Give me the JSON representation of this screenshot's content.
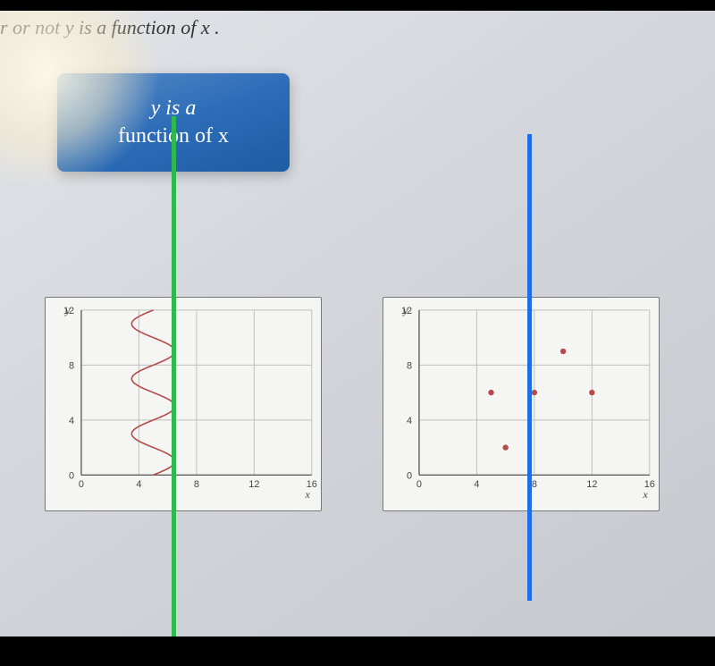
{
  "question": {
    "fragment": "r or not y is a function of x ."
  },
  "label_card": {
    "line1": "y is a",
    "line2": "function of x"
  },
  "axes": {
    "y_label": "y",
    "x_label": "x",
    "y_ticks": [
      0,
      4,
      8,
      12
    ],
    "x_ticks": [
      0,
      4,
      8,
      12,
      16
    ]
  },
  "chart_data": [
    {
      "type": "line",
      "title": "",
      "xlabel": "x",
      "ylabel": "y",
      "xlim": [
        0,
        16
      ],
      "ylim": [
        0,
        12
      ],
      "description": "Vertical sinusoidal curve (x as a function of y): x = 5 + 1.5*sin(pi*y/2), y from 0 to 12",
      "series": [
        {
          "name": "curve",
          "y": [
            0,
            1,
            2,
            3,
            4,
            5,
            6,
            7,
            8,
            9,
            10,
            11,
            12
          ],
          "x": [
            5.0,
            6.5,
            5.0,
            3.5,
            5.0,
            6.5,
            5.0,
            3.5,
            5.0,
            6.5,
            5.0,
            3.5,
            5.0
          ]
        }
      ]
    },
    {
      "type": "scatter",
      "title": "",
      "xlabel": "x",
      "ylabel": "y",
      "xlim": [
        0,
        16
      ],
      "ylim": [
        0,
        12
      ],
      "series": [
        {
          "name": "points",
          "x": [
            5,
            6,
            8,
            10,
            12
          ],
          "y": [
            6,
            2,
            6,
            9,
            6
          ]
        }
      ]
    }
  ],
  "overlays": {
    "green_line_x": 5.5,
    "blue_line_x": 8
  }
}
